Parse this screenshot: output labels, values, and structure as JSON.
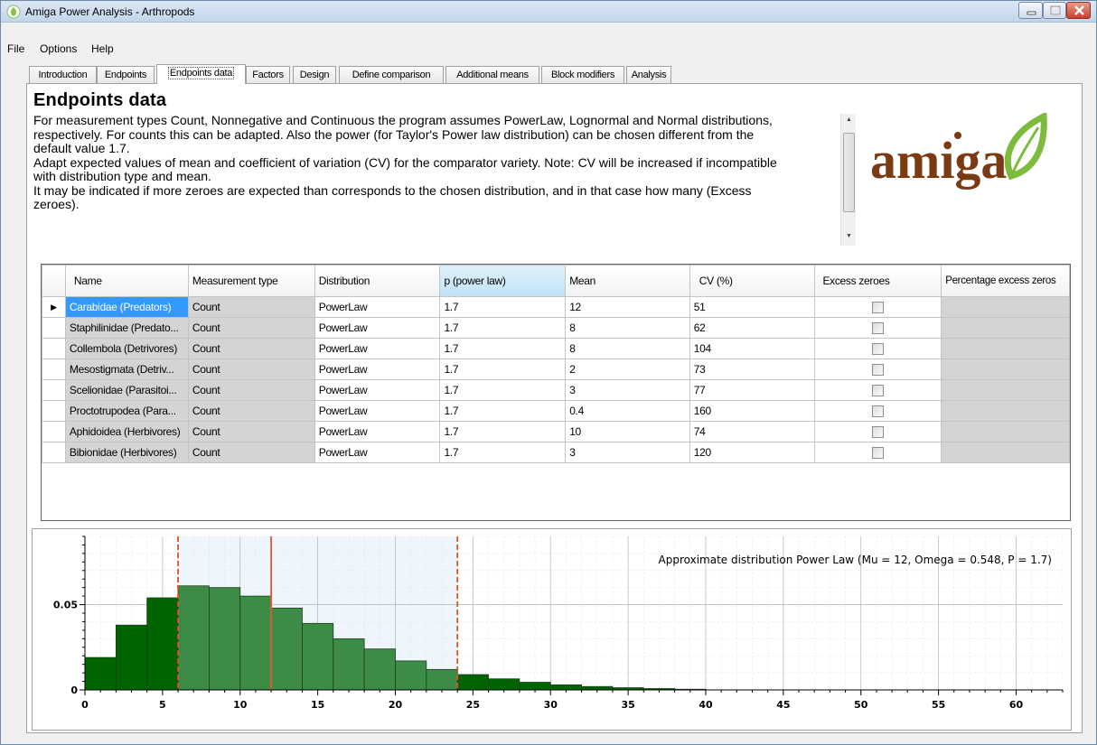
{
  "window": {
    "title": "Amiga Power Analysis - Arthropods"
  },
  "menu": [
    "File",
    "Options",
    "Help"
  ],
  "tabs": [
    {
      "label": "Introduction"
    },
    {
      "label": "Endpoints"
    },
    {
      "label": "Endpoints data",
      "active": true
    },
    {
      "label": "Factors"
    },
    {
      "label": "Design"
    },
    {
      "label": "Define comparison"
    },
    {
      "label": "Additional means"
    },
    {
      "label": "Block modifiers"
    },
    {
      "label": "Analysis"
    }
  ],
  "page": {
    "heading": "Endpoints data",
    "description_lines": [
      "For measurement types Count, Nonnegative and Continuous the program assumes PowerLaw, Lognormal and Normal distributions,",
      "respectively. For counts this can be adapted. Also the power (for Taylor's Power law distribution) can be chosen different from the",
      "default value 1.7.",
      "Adapt expected values of mean and coefficient of variation (CV) for the comparator variety. Note: CV will be increased if incompatible",
      "with distribution type and mean.",
      "It may be indicated if more zeroes are expected than corresponds to the chosen distribution, and in that case how many (Excess",
      "zeroes)."
    ]
  },
  "logo": {
    "text": "amiga",
    "color": "#7a3a12",
    "leaf_color": "#7dbb3c"
  },
  "grid": {
    "columns": [
      "Name",
      "Measurement type",
      "Distribution",
      "p (power law)",
      "Mean",
      "CV (%)",
      "Excess zeroes",
      "Percentage excess zeros"
    ],
    "rows": [
      {
        "name": "Carabidae (Predators)",
        "type": "Count",
        "dist": "PowerLaw",
        "p": "1.7",
        "mean": "12",
        "cv": "51",
        "excess": false,
        "selected": true
      },
      {
        "name": "Staphilinidae (Predato...",
        "type": "Count",
        "dist": "PowerLaw",
        "p": "1.7",
        "mean": "8",
        "cv": "62",
        "excess": false
      },
      {
        "name": "Collembola (Detrivores)",
        "type": "Count",
        "dist": "PowerLaw",
        "p": "1.7",
        "mean": "8",
        "cv": "104",
        "excess": false
      },
      {
        "name": "Mesostigmata (Detriv...",
        "type": "Count",
        "dist": "PowerLaw",
        "p": "1.7",
        "mean": "2",
        "cv": "73",
        "excess": false
      },
      {
        "name": "Scelionidae (Parasitoi...",
        "type": "Count",
        "dist": "PowerLaw",
        "p": "1.7",
        "mean": "3",
        "cv": "77",
        "excess": false
      },
      {
        "name": "Proctotrupodea (Para...",
        "type": "Count",
        "dist": "PowerLaw",
        "p": "1.7",
        "mean": "0.4",
        "cv": "160",
        "excess": false
      },
      {
        "name": "Aphidoidea (Herbivores)",
        "type": "Count",
        "dist": "PowerLaw",
        "p": "1.7",
        "mean": "10",
        "cv": "74",
        "excess": false
      },
      {
        "name": "Bibionidae (Herbivores)",
        "type": "Count",
        "dist": "PowerLaw",
        "p": "1.7",
        "mean": "3",
        "cv": "120",
        "excess": false
      }
    ]
  },
  "chart_data": {
    "type": "bar",
    "title": "Approximate distribution Power Law (Mu = 12, Omega = 0.548, P = 1.7)",
    "xlim": [
      0,
      63
    ],
    "ylim": [
      0,
      0.09
    ],
    "xticks": [
      0,
      5,
      10,
      15,
      20,
      25,
      30,
      35,
      40,
      45,
      50,
      55,
      60
    ],
    "yticks": [
      0,
      0.05
    ],
    "ytick_labels": [
      "0",
      "0.05"
    ],
    "bin_width": 2,
    "bins": [
      {
        "x0": 0,
        "x1": 2,
        "value": 0.019
      },
      {
        "x0": 2,
        "x1": 4,
        "value": 0.038
      },
      {
        "x0": 4,
        "x1": 6,
        "value": 0.054
      },
      {
        "x0": 6,
        "x1": 8,
        "value": 0.061
      },
      {
        "x0": 8,
        "x1": 10,
        "value": 0.06
      },
      {
        "x0": 10,
        "x1": 12,
        "value": 0.055
      },
      {
        "x0": 12,
        "x1": 14,
        "value": 0.048
      },
      {
        "x0": 14,
        "x1": 16,
        "value": 0.039
      },
      {
        "x0": 16,
        "x1": 18,
        "value": 0.03
      },
      {
        "x0": 18,
        "x1": 20,
        "value": 0.024
      },
      {
        "x0": 20,
        "x1": 22,
        "value": 0.017
      },
      {
        "x0": 22,
        "x1": 24,
        "value": 0.012
      },
      {
        "x0": 24,
        "x1": 26,
        "value": 0.009
      },
      {
        "x0": 26,
        "x1": 28,
        "value": 0.0065
      },
      {
        "x0": 28,
        "x1": 30,
        "value": 0.0045
      },
      {
        "x0": 30,
        "x1": 32,
        "value": 0.003
      },
      {
        "x0": 32,
        "x1": 34,
        "value": 0.002
      },
      {
        "x0": 34,
        "x1": 36,
        "value": 0.0013
      },
      {
        "x0": 36,
        "x1": 38,
        "value": 0.0008
      },
      {
        "x0": 38,
        "x1": 40,
        "value": 0.0004
      }
    ],
    "highlight_range": [
      6,
      24
    ],
    "mean_line": 12,
    "interval_lines": [
      6,
      24
    ],
    "colors": {
      "bar_outside": "#006400",
      "bar_inside": "#3c8c48",
      "mean_line": "#e8552e",
      "interval_line": "#e05020",
      "band": "#eef5fd"
    }
  }
}
